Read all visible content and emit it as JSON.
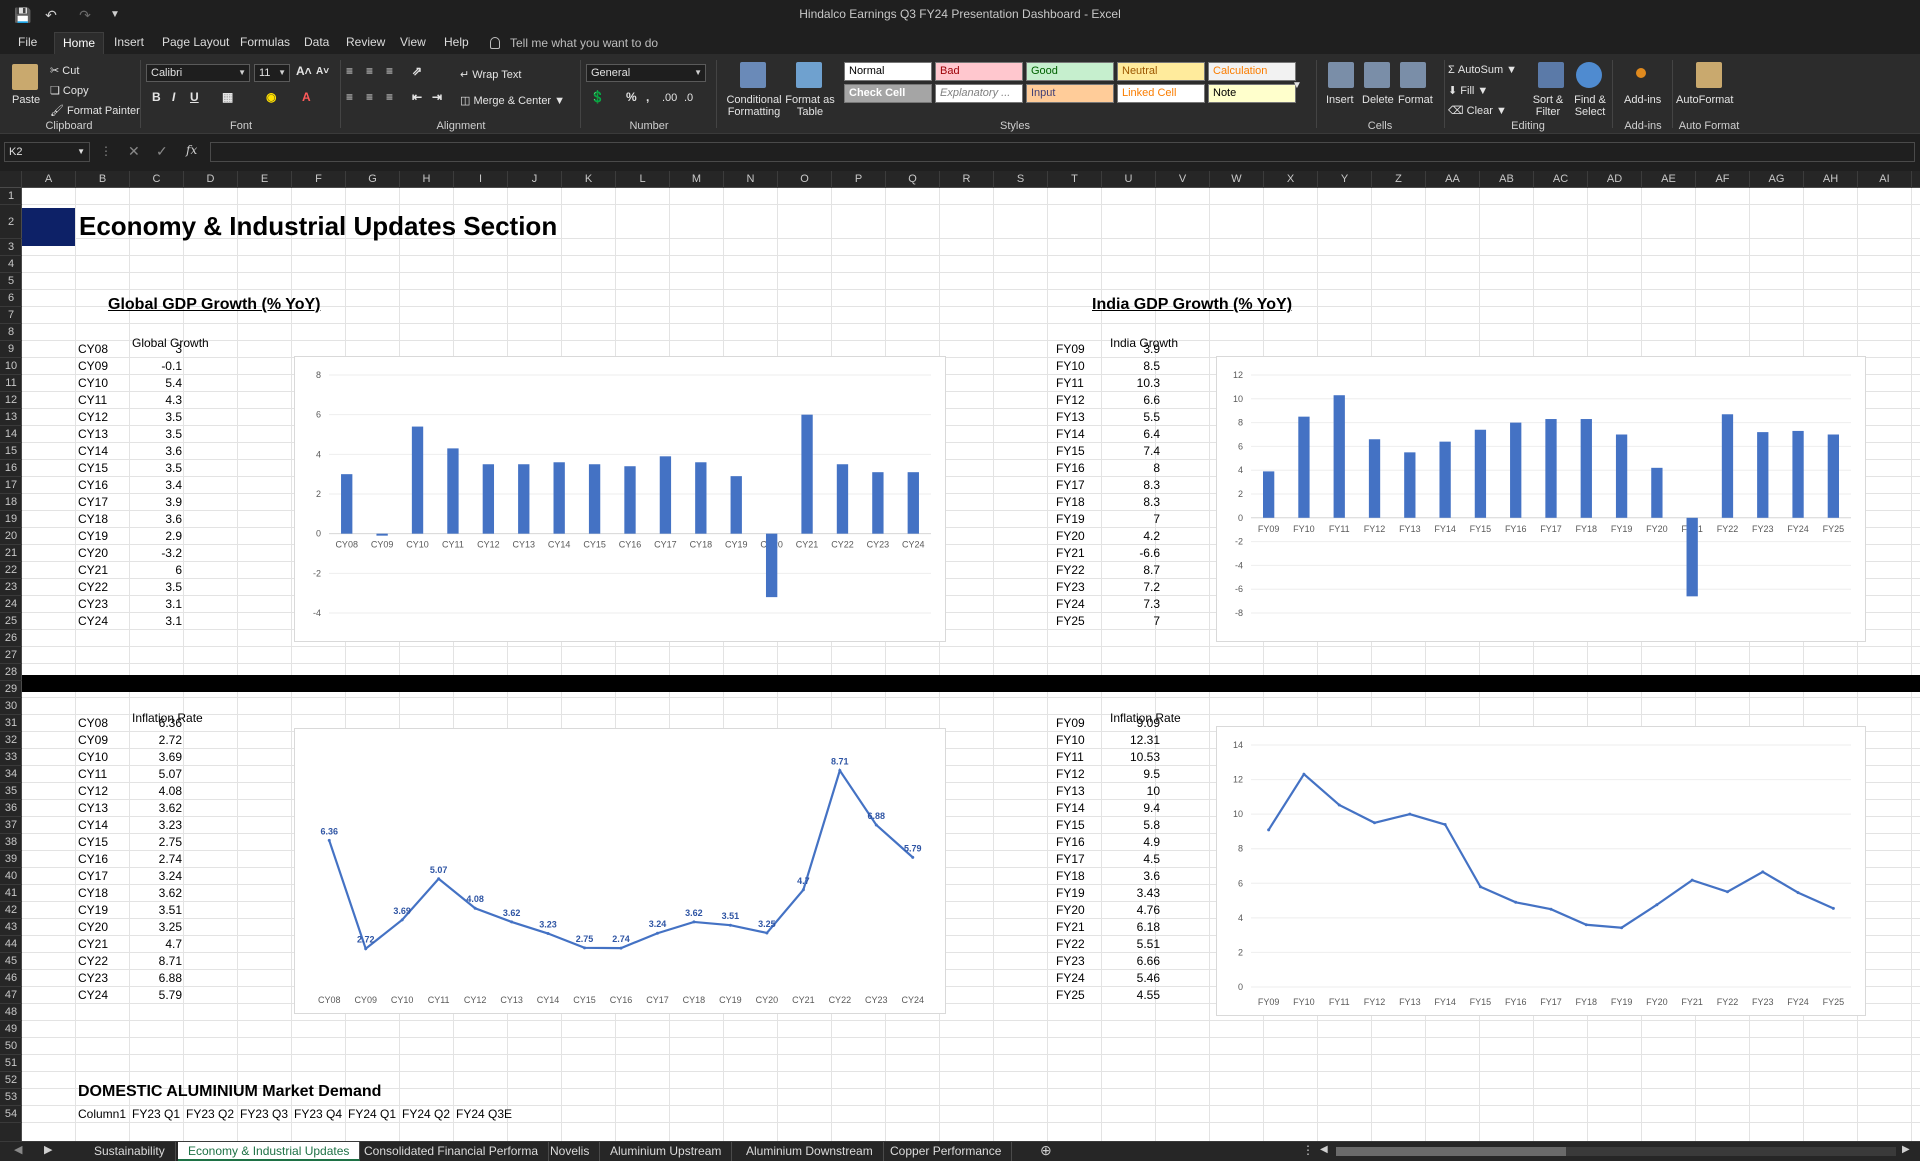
{
  "window": {
    "title": "Hindalco Earnings Q3 FY24 Presentation Dashboard  -  Excel"
  },
  "menu": [
    "File",
    "Home",
    "Insert",
    "Page Layout",
    "Formulas",
    "Data",
    "Review",
    "View",
    "Help"
  ],
  "tell_me": "Tell me what you want to do",
  "ribbon": {
    "clipboard": {
      "paste": "Paste",
      "cut": "Cut",
      "copy": "Copy",
      "format_painter": "Format Painter",
      "label": "Clipboard"
    },
    "font": {
      "name": "Calibri",
      "size": "11",
      "label": "Font"
    },
    "alignment": {
      "wrap": "Wrap Text",
      "merge": "Merge & Center",
      "label": "Alignment"
    },
    "number": {
      "format": "General",
      "label": "Number"
    },
    "styles": {
      "conditional": "Conditional Formatting",
      "format_table": "Format as Table",
      "cells": [
        {
          "label": "Normal",
          "bg": "#ffffff",
          "fg": "#000000"
        },
        {
          "label": "Bad",
          "bg": "#ffc7ce",
          "fg": "#9c0006"
        },
        {
          "label": "Good",
          "bg": "#c6efce",
          "fg": "#006100"
        },
        {
          "label": "Neutral",
          "bg": "#ffeb9c",
          "fg": "#9c5700"
        },
        {
          "label": "Calculation",
          "bg": "#f2f2f2",
          "fg": "#fa7d00"
        },
        {
          "label": "Check Cell",
          "bg": "#a5a5a5",
          "fg": "#ffffff"
        },
        {
          "label": "Explanatory ...",
          "bg": "#ffffff",
          "fg": "#7f7f7f"
        },
        {
          "label": "Input",
          "bg": "#ffcc99",
          "fg": "#3f3f76"
        },
        {
          "label": "Linked Cell",
          "bg": "#ffffff",
          "fg": "#fa7d00"
        },
        {
          "label": "Note",
          "bg": "#ffffcc",
          "fg": "#000000"
        }
      ],
      "label": "Styles"
    },
    "cells": {
      "insert": "Insert",
      "delete": "Delete",
      "format": "Format",
      "label": "Cells"
    },
    "editing": {
      "autosum": "AutoSum",
      "fill": "Fill",
      "clear": "Clear",
      "sort": "Sort & Filter",
      "find": "Find & Select",
      "label": "Editing"
    },
    "addins": {
      "addins": "Add-ins",
      "label": "Add-ins"
    },
    "autoformat": {
      "autoformat": "AutoFormat",
      "label": "Auto Format"
    }
  },
  "formula_bar": {
    "name_box": "K2",
    "formula": ""
  },
  "columns": [
    "A",
    "B",
    "C",
    "D",
    "E",
    "F",
    "G",
    "H",
    "I",
    "J",
    "K",
    "L",
    "M",
    "N",
    "O",
    "P",
    "Q",
    "R",
    "S",
    "T",
    "U",
    "V",
    "W",
    "X",
    "Y",
    "Z",
    "AA",
    "AB",
    "AC",
    "AD",
    "AE",
    "AF",
    "AG",
    "AH",
    "AI"
  ],
  "rows": [
    "1",
    "2",
    "3",
    "4",
    "5",
    "6",
    "7",
    "8",
    "9",
    "10",
    "11",
    "12",
    "13",
    "14",
    "15",
    "16",
    "17",
    "18",
    "19",
    "20",
    "21",
    "22",
    "23",
    "24",
    "25",
    "26",
    "27",
    "28",
    "29",
    "30",
    "31",
    "32",
    "33",
    "34",
    "35",
    "36",
    "37",
    "38",
    "39",
    "40",
    "41",
    "42",
    "43",
    "44",
    "45",
    "46",
    "47",
    "48",
    "49",
    "50",
    "51",
    "52",
    "53",
    "54"
  ],
  "sheet": {
    "section_title": "Economy & Industrial Updates Section",
    "global_gdp_heading": "Global GDP Growth (% YoY) ",
    "india_gdp_heading": "India GDP Growth (% YoY) ",
    "global_growth_label": "Global Growth",
    "india_growth_label": "India Growth",
    "global_inflation_label": "Inflation Rate",
    "india_inflation_label": "Inflation Rate",
    "domestic_heading": "DOMESTIC ALUMINIUM Market Demand",
    "domestic_header": [
      "Column1",
      "FY23 Q1",
      "FY23 Q2",
      "FY23 Q3",
      "FY23 Q4",
      "FY24 Q1",
      "FY24 Q2",
      "FY24 Q3E"
    ],
    "global_gdp": {
      "years": [
        "CY08",
        "CY09",
        "CY10",
        "CY11",
        "CY12",
        "CY13",
        "CY14",
        "CY15",
        "CY16",
        "CY17",
        "CY18",
        "CY19",
        "CY20",
        "CY21",
        "CY22",
        "CY23",
        "CY24"
      ],
      "values": [
        "3",
        "-0.1",
        "5.4",
        "4.3",
        "3.5",
        "3.5",
        "3.6",
        "3.5",
        "3.4",
        "3.9",
        "3.6",
        "2.9",
        "-3.2",
        "6",
        "3.5",
        "3.1",
        "3.1"
      ]
    },
    "india_gdp": {
      "years": [
        "FY09",
        "FY10",
        "FY11",
        "FY12",
        "FY13",
        "FY14",
        "FY15",
        "FY16",
        "FY17",
        "FY18",
        "FY19",
        "FY20",
        "FY21",
        "FY22",
        "FY23",
        "FY24",
        "FY25"
      ],
      "values": [
        "3.9",
        "8.5",
        "10.3",
        "6.6",
        "5.5",
        "6.4",
        "7.4",
        "8",
        "8.3",
        "8.3",
        "7",
        "4.2",
        "-6.6",
        "8.7",
        "7.2",
        "7.3",
        "7"
      ]
    },
    "global_inflation": {
      "years": [
        "CY08",
        "CY09",
        "CY10",
        "CY11",
        "CY12",
        "CY13",
        "CY14",
        "CY15",
        "CY16",
        "CY17",
        "CY18",
        "CY19",
        "CY20",
        "CY21",
        "CY22",
        "CY23",
        "CY24"
      ],
      "values": [
        "6.36",
        "2.72",
        "3.69",
        "5.07",
        "4.08",
        "3.62",
        "3.23",
        "2.75",
        "2.74",
        "3.24",
        "3.62",
        "3.51",
        "3.25",
        "4.7",
        "8.71",
        "6.88",
        "5.79"
      ]
    },
    "india_inflation": {
      "years": [
        "FY09",
        "FY10",
        "FY11",
        "FY12",
        "FY13",
        "FY14",
        "FY15",
        "FY16",
        "FY17",
        "FY18",
        "FY19",
        "FY20",
        "FY21",
        "FY22",
        "FY23",
        "FY24",
        "FY25"
      ],
      "values": [
        "9.09",
        "12.31",
        "10.53",
        "9.5",
        "10",
        "9.4",
        "5.8",
        "4.9",
        "4.5",
        "3.6",
        "3.43",
        "4.76",
        "6.18",
        "5.51",
        "6.66",
        "5.46",
        "4.55"
      ]
    }
  },
  "chart_data": [
    {
      "type": "bar",
      "categories": [
        "CY08",
        "CY09",
        "CY10",
        "CY11",
        "CY12",
        "CY13",
        "CY14",
        "CY15",
        "CY16",
        "CY17",
        "CY18",
        "CY19",
        "CY20",
        "CY21",
        "CY22",
        "CY23",
        "CY24"
      ],
      "values": [
        3,
        -0.1,
        5.4,
        4.3,
        3.5,
        3.5,
        3.6,
        3.5,
        3.4,
        3.9,
        3.6,
        2.9,
        -3.2,
        6,
        3.5,
        3.1,
        3.1
      ],
      "ylim": [
        -4,
        8
      ],
      "yticks": [
        -4,
        -2,
        0,
        2,
        4,
        6,
        8
      ],
      "color": "#4472c4",
      "data_labels": false
    },
    {
      "type": "bar",
      "categories": [
        "FY09",
        "FY10",
        "FY11",
        "FY12",
        "FY13",
        "FY14",
        "FY15",
        "FY16",
        "FY17",
        "FY18",
        "FY19",
        "FY20",
        "FY21",
        "FY22",
        "FY23",
        "FY24",
        "FY25"
      ],
      "values": [
        3.9,
        8.5,
        10.3,
        6.6,
        5.5,
        6.4,
        7.4,
        8,
        8.3,
        8.3,
        7,
        4.2,
        -6.6,
        8.7,
        7.2,
        7.3,
        7
      ],
      "ylim": [
        -8,
        12
      ],
      "yticks": [
        -8,
        -6,
        -4,
        -2,
        0,
        2,
        4,
        6,
        8,
        10,
        12
      ],
      "color": "#4472c4",
      "data_labels": false
    },
    {
      "type": "line",
      "categories": [
        "CY08",
        "CY09",
        "CY10",
        "CY11",
        "CY12",
        "CY13",
        "CY14",
        "CY15",
        "CY16",
        "CY17",
        "CY18",
        "CY19",
        "CY20",
        "CY21",
        "CY22",
        "CY23",
        "CY24"
      ],
      "values": [
        6.36,
        2.72,
        3.69,
        5.07,
        4.08,
        3.62,
        3.23,
        2.75,
        2.74,
        3.24,
        3.62,
        3.51,
        3.25,
        4.7,
        8.71,
        6.88,
        5.79
      ],
      "ylim": [
        1.5,
        9.5
      ],
      "yticks": [],
      "color": "#4472c4",
      "data_labels": true
    },
    {
      "type": "line",
      "categories": [
        "FY09",
        "FY10",
        "FY11",
        "FY12",
        "FY13",
        "FY14",
        "FY15",
        "FY16",
        "FY17",
        "FY18",
        "FY19",
        "FY20",
        "FY21",
        "FY22",
        "FY23",
        "FY24",
        "FY25"
      ],
      "values": [
        9.09,
        12.31,
        10.53,
        9.5,
        10,
        9.4,
        5.8,
        4.9,
        4.5,
        3.6,
        3.43,
        4.76,
        6.18,
        5.51,
        6.66,
        5.46,
        4.55
      ],
      "ylim": [
        0,
        14
      ],
      "yticks": [
        0,
        2,
        4,
        6,
        8,
        10,
        12,
        14
      ],
      "color": "#4472c4",
      "data_labels": false
    }
  ],
  "sheet_tabs": [
    "Sustainability",
    "Economy & Industrial Updates",
    "Consolidated Financial Performa",
    "Novelis",
    "Aluminium Upstream",
    "Aluminium Downstream",
    "Copper Performance"
  ],
  "active_tab": "Economy & Industrial Updates"
}
